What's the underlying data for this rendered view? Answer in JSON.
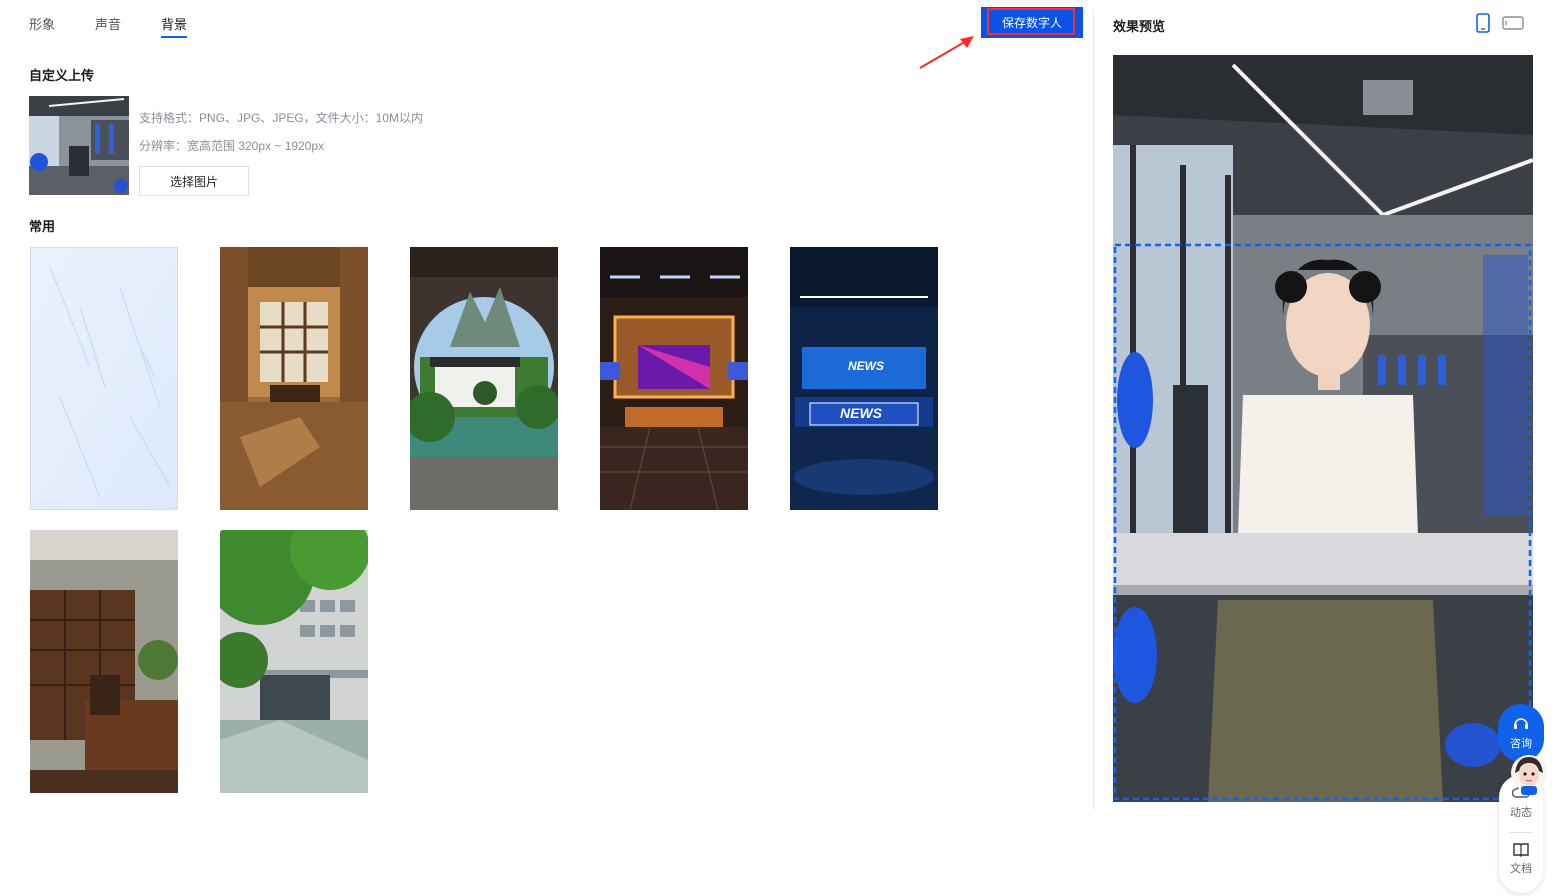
{
  "tabs": [
    {
      "label": "形象",
      "active": false
    },
    {
      "label": "声音",
      "active": false
    },
    {
      "label": "背景",
      "active": true
    }
  ],
  "toolbar": {
    "save_label": "保存数字人"
  },
  "upload": {
    "title": "自定义上传",
    "format_hint": "支持格式：PNG、JPG、JPEG，文件大小：10M以内",
    "resolution_hint": "分辨率：宽高范围 320px ~ 1920px",
    "select_label": "选择图片"
  },
  "common": {
    "title": "常用",
    "backgrounds": [
      {
        "name": "light-blue-texture"
      },
      {
        "name": "wood-hall"
      },
      {
        "name": "chinese-garden"
      },
      {
        "name": "tv-studio"
      },
      {
        "name": "news-studio",
        "labels": [
          "NEWS",
          "NEWS"
        ]
      },
      {
        "name": "office"
      },
      {
        "name": "campus-building"
      }
    ]
  },
  "preview": {
    "title": "效果预览"
  },
  "float": {
    "consult_label": "咨询",
    "dynamic_label": "动态",
    "docs_label": "文档"
  },
  "colors": {
    "accent": "#0a53e6",
    "highlight": "#ff2a2a"
  }
}
